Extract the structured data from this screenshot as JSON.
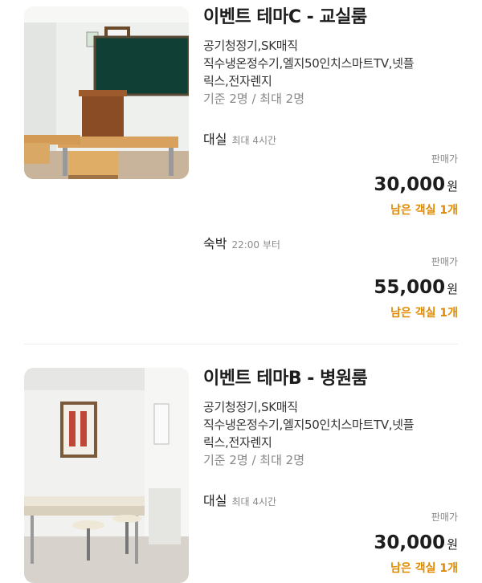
{
  "rooms": [
    {
      "image": "classroom-photo",
      "title": "이벤트 테마C - 교실룸",
      "amenities": [
        "공기청정기,SK매직",
        "직수냉온정수기,엘지50인치스마트TV,넷플",
        "릭스,전자렌지"
      ],
      "capacity": "기준 2명 / 최대 2명",
      "options": [
        {
          "label": "대실",
          "sub": "최대 4시간",
          "price_caption": "판매가",
          "price": "30,000",
          "currency": "원",
          "remaining": "남은 객실 1개"
        },
        {
          "label": "숙박",
          "sub": "22:00 부터",
          "price_caption": "판매가",
          "price": "55,000",
          "currency": "원",
          "remaining": "남은 객실 1개"
        }
      ]
    },
    {
      "image": "hospital-room-photo",
      "title": "이벤트 테마B - 병원룸",
      "amenities": [
        "공기청정기,SK매직",
        "직수냉온정수기,엘지50인치스마트TV,넷플",
        "릭스,전자렌지"
      ],
      "capacity": "기준 2명 / 최대 2명",
      "options": [
        {
          "label": "대실",
          "sub": "최대 4시간",
          "price_caption": "판매가",
          "price": "30,000",
          "currency": "원",
          "remaining": "남은 객실 1개"
        }
      ]
    }
  ],
  "colors": {
    "remaining": "#e08a00",
    "text": "#1d1d1d",
    "muted": "#888888"
  }
}
